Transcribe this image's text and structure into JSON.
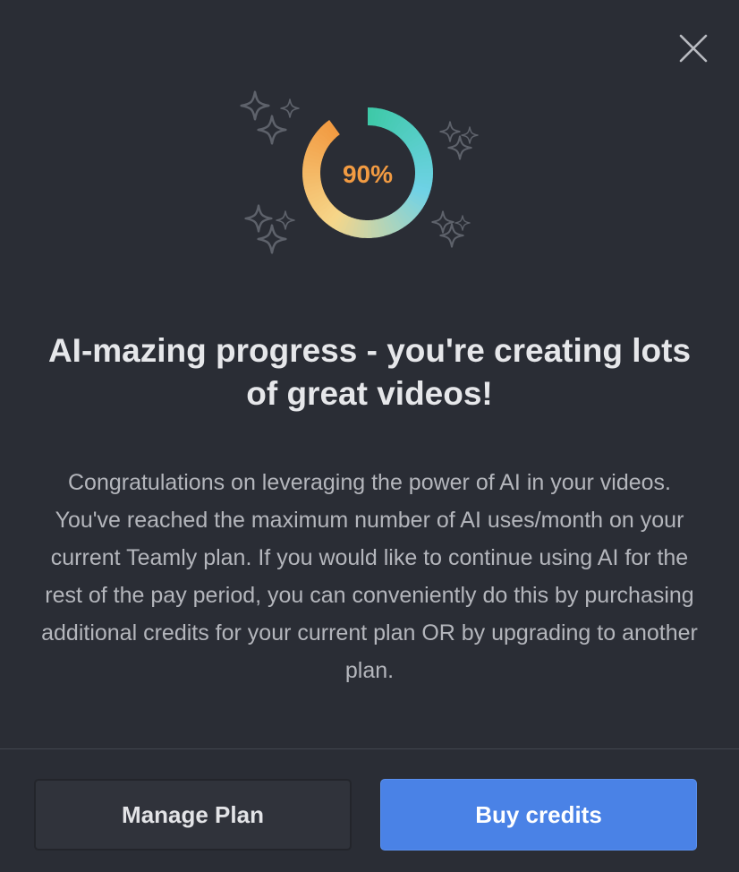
{
  "dialog": {
    "progress": {
      "label": "90%",
      "percent": 90,
      "label_color": "#f29b42",
      "gradient_colors": [
        "#f29b42",
        "#f6d68a",
        "#6fd2e6",
        "#3ec9a8"
      ]
    },
    "headline": "AI-mazing progress - you're creating lots of great videos!",
    "body": "Congratulations on leveraging the power of AI in your videos. You've reached the maximum number of AI uses/month on your current Teamly plan. If you would like to continue using AI for the rest of the pay period, you can conveniently do this by purchasing additional credits for your current plan OR by upgrading to another plan.",
    "buttons": {
      "manage_plan": "Manage Plan",
      "buy_credits": "Buy credits"
    },
    "colors": {
      "background": "#2a2d35",
      "primary_button": "#4a82e6",
      "secondary_button": "#30333b"
    },
    "icons": {
      "close": "close-icon",
      "decoration": "sparkle-icon"
    }
  }
}
